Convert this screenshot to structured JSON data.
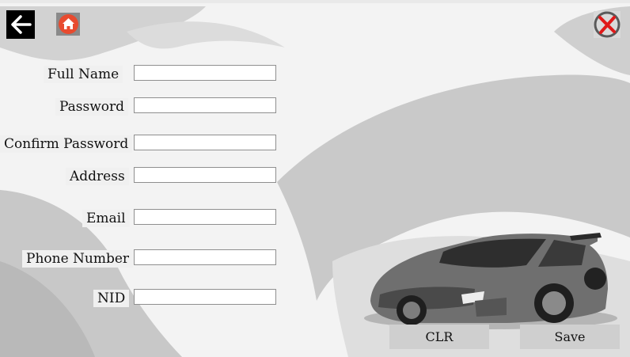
{
  "window": {
    "background": "#f2f2f2"
  },
  "toolbar": {
    "back_icon": "arrow-left-icon",
    "home_icon": "home-icon",
    "close_icon": "close-x-icon",
    "home_color": "#e84b2f",
    "close_color": "#e01919"
  },
  "form": {
    "fields": [
      {
        "key": "full_name",
        "label": "Full Name",
        "value": "",
        "placeholder": ""
      },
      {
        "key": "password",
        "label": "Password",
        "value": "",
        "placeholder": ""
      },
      {
        "key": "confirm_password",
        "label": "Confirm Password",
        "value": "",
        "placeholder": ""
      },
      {
        "key": "address",
        "label": "Address",
        "value": "",
        "placeholder": ""
      },
      {
        "key": "email",
        "label": "Email",
        "value": "",
        "placeholder": ""
      },
      {
        "key": "phone_number",
        "label": "Phone Number",
        "value": "",
        "placeholder": ""
      },
      {
        "key": "nid",
        "label": "NID",
        "value": "",
        "placeholder": ""
      }
    ]
  },
  "actions": {
    "clear_label": "CLR",
    "save_label": "Save"
  },
  "decor": {
    "car_image": "sports-car-illustration"
  }
}
